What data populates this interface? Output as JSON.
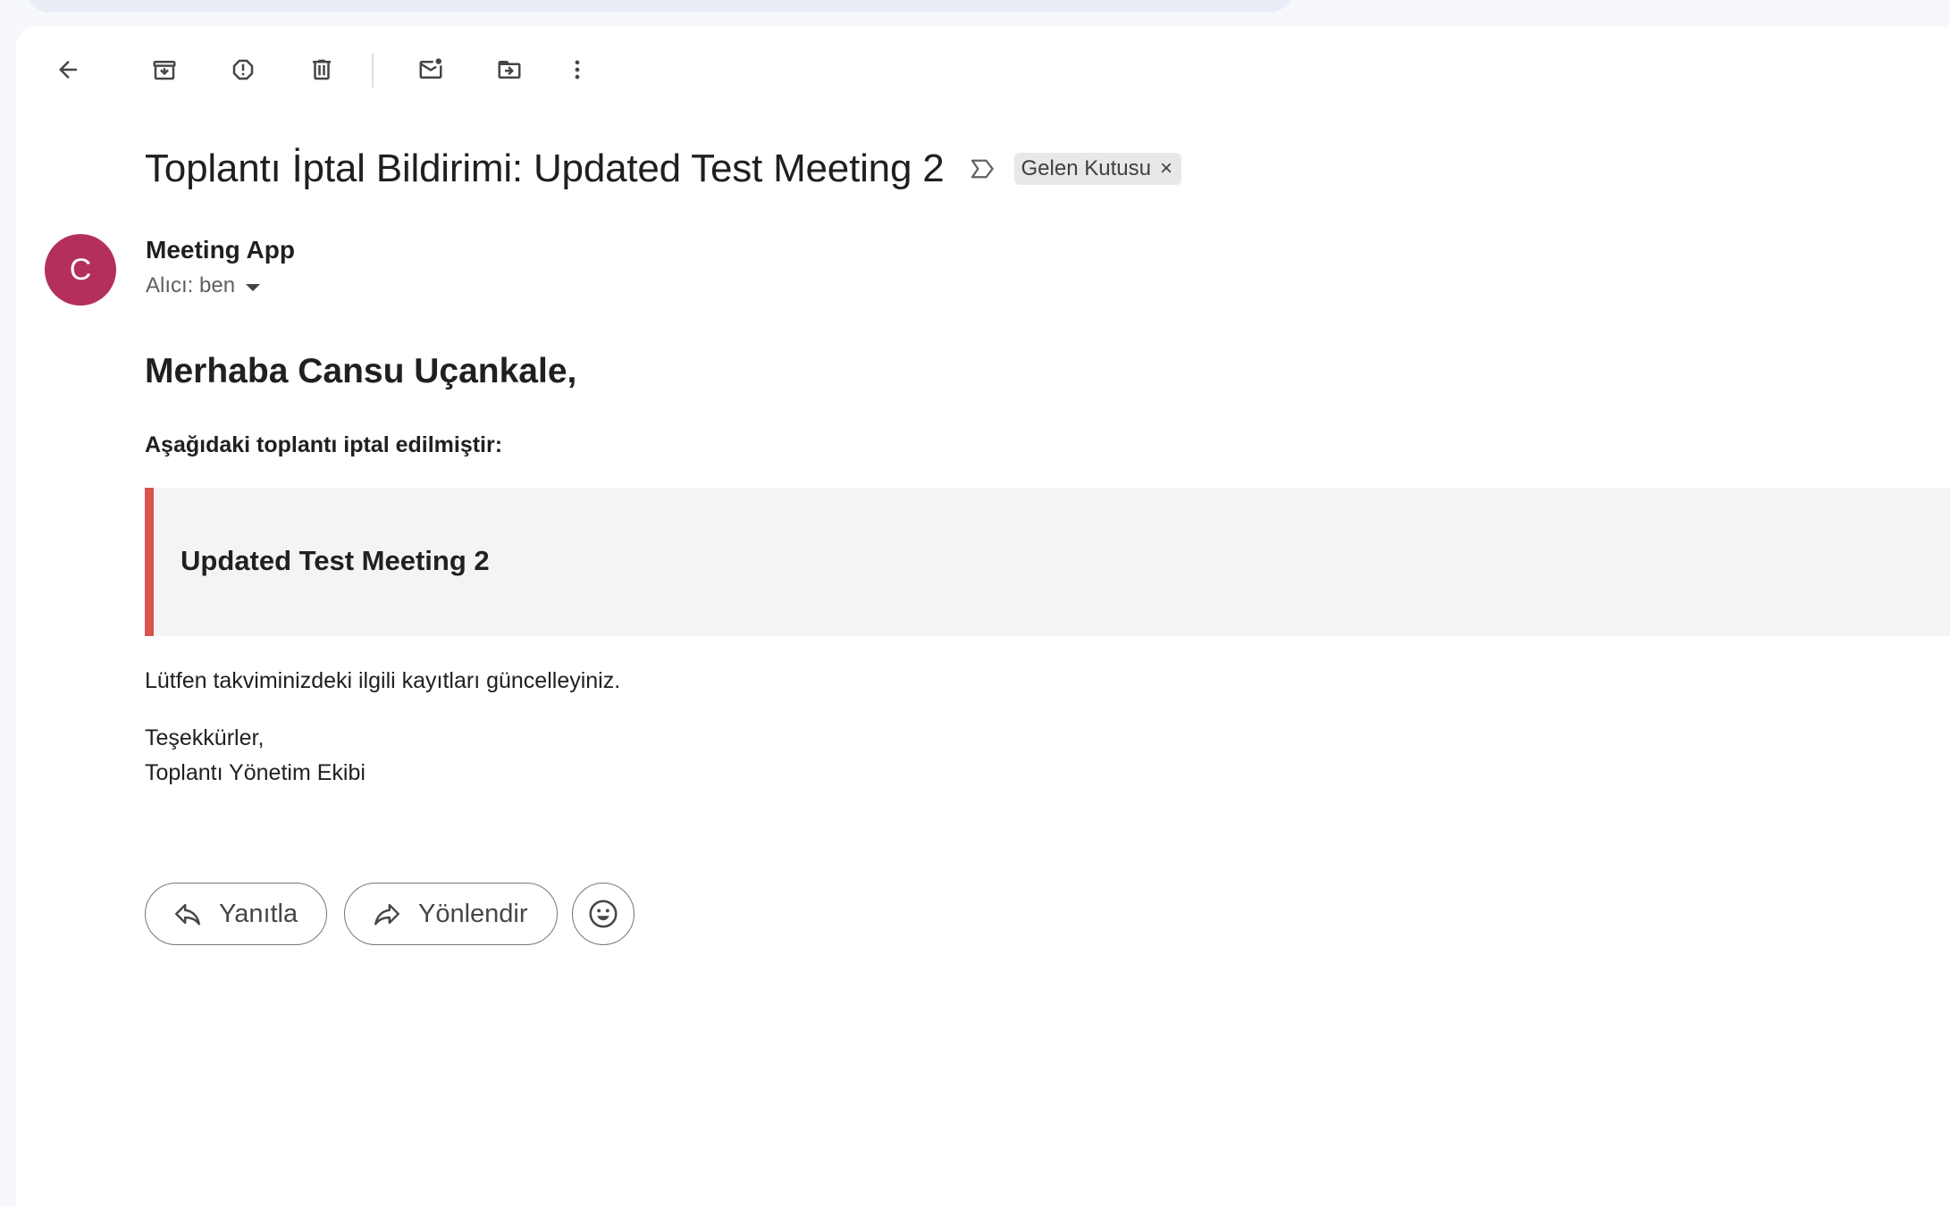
{
  "toolbar": {
    "icons": [
      "back-arrow-icon",
      "archive-icon",
      "report-spam-icon",
      "delete-icon",
      "mark-unread-icon",
      "move-to-icon",
      "more-vert-icon"
    ]
  },
  "email": {
    "subject": "Toplantı İptal Bildirimi: Updated Test Meeting 2",
    "label": "Gelen Kutusu",
    "label_remove": "×",
    "sender": {
      "avatar_letter": "C",
      "avatar_color": "#b42f5e",
      "name": "Meeting App",
      "recipient": "Alıcı: ben"
    },
    "body": {
      "greeting": "Merhaba Cansu Uçankale,",
      "intro": "Aşağıdaki toplantı iptal edilmiştir:",
      "meeting_title": "Updated Test Meeting 2",
      "accent_color": "#d9534f",
      "note": "Lütfen takviminizdeki ilgili kayıtları güncelleyiniz.",
      "thanks": "Teşekkürler,",
      "signature": "Toplantı Yönetim Ekibi"
    }
  },
  "actions": {
    "reply_label": "Yanıtla",
    "forward_label": "Yönlendir",
    "emoji_icon": "smiley-icon"
  }
}
